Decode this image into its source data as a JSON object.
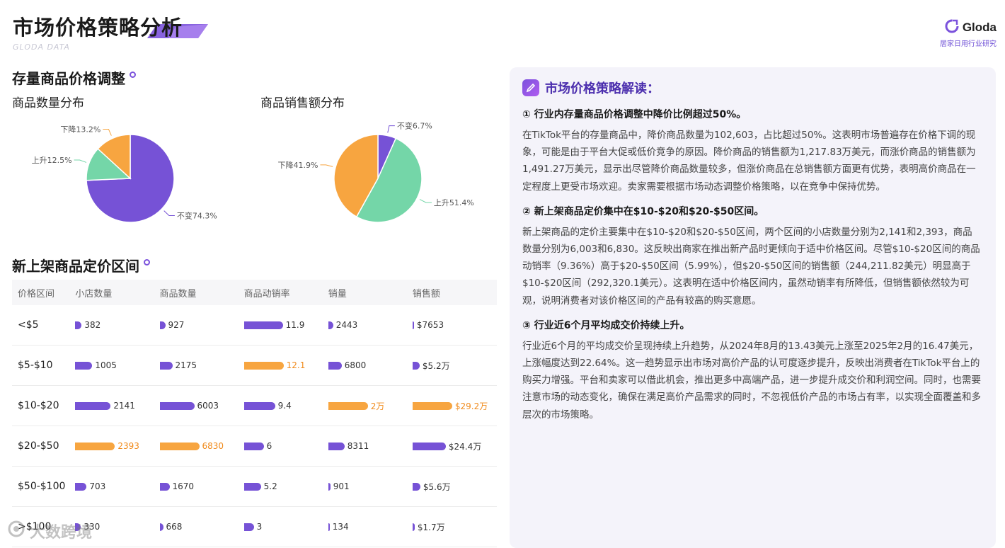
{
  "header": {
    "title": "市场价格策略分析",
    "subtitle": "GLODA DATA",
    "brand_name": "Gloda",
    "brand_tagline": "居家日用行业研究"
  },
  "section1": {
    "title": "存量商品价格调整"
  },
  "section2": {
    "title": "新上架商品定价区间"
  },
  "colors": {
    "purple": "#7652d6",
    "green": "#74d6a8",
    "orange": "#f7a540",
    "title_purple": "#4c2fae"
  },
  "chart_data": [
    {
      "type": "pie",
      "title": "商品数量分布",
      "slices": [
        {
          "name": "不变",
          "value": 74.3,
          "label": "不变74.3%",
          "color": "#7652d6"
        },
        {
          "name": "上升",
          "value": 12.5,
          "label": "上升12.5%",
          "color": "#74d6a8"
        },
        {
          "name": "下降",
          "value": 13.2,
          "label": "下降13.2%",
          "color": "#f7a540"
        }
      ]
    },
    {
      "type": "pie",
      "title": "商品销售额分布",
      "slices": [
        {
          "name": "不变",
          "value": 6.7,
          "label": "不变6.7%",
          "color": "#7652d6"
        },
        {
          "name": "上升",
          "value": 51.4,
          "label": "上升51.4%",
          "color": "#74d6a8"
        },
        {
          "name": "下降",
          "value": 41.9,
          "label": "下降41.9%",
          "color": "#f7a540"
        }
      ]
    },
    {
      "type": "table",
      "columns": [
        "价格区间",
        "小店数量",
        "商品数量",
        "商品动销率",
        "销量",
        "销售额"
      ],
      "rows": [
        {
          "range": "<$5",
          "cells": [
            {
              "text": "382",
              "value": 382,
              "hl": false
            },
            {
              "text": "927",
              "value": 927,
              "hl": false
            },
            {
              "text": "11.9",
              "value": 11.9,
              "hl": false
            },
            {
              "text": "2443",
              "value": 2443,
              "hl": false
            },
            {
              "text": "$7653",
              "value": 7653,
              "hl": false
            }
          ]
        },
        {
          "range": "$5-$10",
          "cells": [
            {
              "text": "1005",
              "value": 1005,
              "hl": false
            },
            {
              "text": "2175",
              "value": 2175,
              "hl": false
            },
            {
              "text": "12.1",
              "value": 12.1,
              "hl": true
            },
            {
              "text": "6800",
              "value": 6800,
              "hl": false
            },
            {
              "text": "$5.2万",
              "value": 52000,
              "hl": false
            }
          ]
        },
        {
          "range": "$10-$20",
          "cells": [
            {
              "text": "2141",
              "value": 2141,
              "hl": false
            },
            {
              "text": "6003",
              "value": 6003,
              "hl": false
            },
            {
              "text": "9.4",
              "value": 9.4,
              "hl": false
            },
            {
              "text": "2万",
              "value": 20000,
              "hl": true
            },
            {
              "text": "$29.2万",
              "value": 292000,
              "hl": true
            }
          ]
        },
        {
          "range": "$20-$50",
          "cells": [
            {
              "text": "2393",
              "value": 2393,
              "hl": true
            },
            {
              "text": "6830",
              "value": 6830,
              "hl": true
            },
            {
              "text": "6",
              "value": 6,
              "hl": false
            },
            {
              "text": "8311",
              "value": 8311,
              "hl": false
            },
            {
              "text": "$24.4万",
              "value": 244000,
              "hl": false
            }
          ]
        },
        {
          "range": "$50-$100",
          "cells": [
            {
              "text": "703",
              "value": 703,
              "hl": false
            },
            {
              "text": "1670",
              "value": 1670,
              "hl": false
            },
            {
              "text": "5.2",
              "value": 5.2,
              "hl": false
            },
            {
              "text": "901",
              "value": 901,
              "hl": false
            },
            {
              "text": "$5.6万",
              "value": 56000,
              "hl": false
            }
          ]
        },
        {
          "range": ">$100",
          "cells": [
            {
              "text": "330",
              "value": 330,
              "hl": false
            },
            {
              "text": "668",
              "value": 668,
              "hl": false
            },
            {
              "text": "3",
              "value": 3,
              "hl": false
            },
            {
              "text": "134",
              "value": 134,
              "hl": false
            },
            {
              "text": "$1.7万",
              "value": 17000,
              "hl": false
            }
          ]
        }
      ]
    }
  ],
  "analysis": {
    "title": "市场价格策略解读：",
    "points": [
      {
        "title": "① 行业内存量商品价格调整中降价比例超过50%。",
        "body": "在TikTok平台的存量商品中，降价商品数量为102,603，占比超过50%。这表明市场普遍存在价格下调的现象，可能是由于平台大促或低价竞争的原因。降价商品的销售额为1,217.83万美元，而涨价商品的销售额为1,491.27万美元，显示出尽管降价商品数量较多，但涨价商品在总销售额方面更有优势，表明高价商品在一定程度上更受市场欢迎。卖家需要根据市场动态调整价格策略，以在竞争中保持优势。"
      },
      {
        "title": "② 新上架商品定价集中在$10-$20和$20-$50区间。",
        "body": "新上架商品的定价主要集中在$10-$20和$20-$50区间，两个区间的小店数量分别为2,141和2,393，商品数量分别为6,003和6,830。这反映出商家在推出新产品时更倾向于适中价格区间。尽管$10-$20区间的商品动销率（9.36%）高于$20-$50区间（5.99%），但$20-$50区间的销售额（244,211.82美元）明显高于$10-$20区间（292,320.1美元）。这表明在适中价格区间内，虽然动销率有所降低，但销售额依然较为可观，说明消费者对该价格区间的产品有较高的购买意愿。"
      },
      {
        "title": "③ 行业近6个月平均成交价持续上升。",
        "body": "行业近6个月的平均成交价呈现持续上升趋势，从2024年8月的13.43美元上涨至2025年2月的16.47美元，上涨幅度达到22.64%。这一趋势显示出市场对高价产品的认可度逐步提升，反映出消费者在TikTok平台上的购买力增强。平台和卖家可以借此机会，推出更多中高端产品，进一步提升成交价和利润空间。同时，也需要注意市场的动态变化，确保在满足高价产品需求的同时，不忽视低价产品的市场占有率，以实现全面覆盖和多层次的市场策略。"
      }
    ]
  },
  "watermark": {
    "text": "大数跨境"
  }
}
